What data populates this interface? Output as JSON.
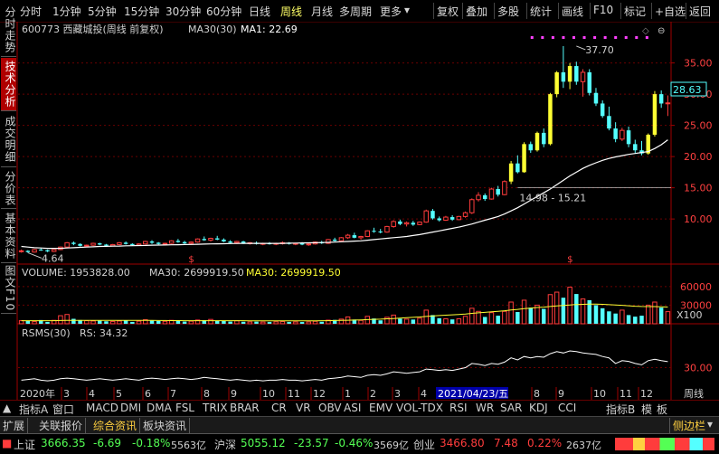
{
  "toolbar": {
    "periods": [
      "分时",
      "1分钟",
      "5分钟",
      "15分钟",
      "30分钟",
      "60分钟",
      "日线",
      "周线",
      "月线",
      "多周期",
      "更多"
    ],
    "active_period": "周线",
    "right_buttons": [
      "复权",
      "叠加",
      "多股",
      "统计",
      "画线",
      "F10",
      "标记",
      "+自选",
      "返回"
    ]
  },
  "left_tabs": [
    "分时走势",
    "技术分析",
    "成交明细",
    "分价表",
    "基本资料",
    "图文F10"
  ],
  "left_tabs_active": "技术分析",
  "header": {
    "stock": "600773 西藏城投(周线 前复权)",
    "ma30": "MA30(30)",
    "ma1": "MA1: 22.69"
  },
  "price_label": "28.63",
  "volume_header": {
    "volume": "VOLUME: 1953828.00",
    "ma30": "MA30: 2699919.50",
    "ma30b": "MA30: 2699919.50"
  },
  "volume_unit": "X100",
  "rsms_header": {
    "name": "RSMS(30)",
    "rs": "RS: 34.32"
  },
  "date_axis": {
    "labels": [
      "2020年",
      "3",
      "4",
      "5",
      "6",
      "7",
      "8",
      "9",
      "10",
      "11",
      "12",
      "1",
      "2",
      "3",
      "4",
      "2021/04/23/五",
      "8",
      "9",
      "10",
      "11",
      "12"
    ],
    "cursor_date": "2021/04/23/五",
    "right_label": "周线"
  },
  "indicator_tabs": [
    "指标A",
    "窗口",
    "MACD",
    "DMI",
    "DMA",
    "FSL",
    "TRIX",
    "BRAR",
    "CR",
    "VR",
    "OBV",
    "ASI",
    "EMV",
    "VOL-TDX",
    "RSI",
    "WR",
    "SAR",
    "KDJ",
    "CCI",
    "指标B",
    "模",
    "板"
  ],
  "sub_tabs": [
    "扩展",
    "关联报价",
    "综合资讯",
    "板块资讯"
  ],
  "sub_tabs_active": "综合资讯",
  "side_label": "侧边栏",
  "status": {
    "idx1_name": "上证",
    "idx1_val": "3666.35",
    "idx1_chg": "-6.69",
    "idx1_pct": "-0.18%",
    "idx1_amt": "5563亿",
    "idx2_name": "沪深",
    "idx2_val": "5055.12",
    "idx2_chg": "-23.57",
    "idx2_pct": "-0.46%",
    "idx2_amt": "3569亿",
    "idx3_name": "创业",
    "idx3_val": "3466.80",
    "idx3_chg": "7.48",
    "idx3_pct": "0.22%",
    "idx3_amt": "2637亿"
  },
  "colors": {
    "up": "#ff3c3c",
    "down": "#54ffff",
    "yellow": "#ffff33",
    "ma": "#ffffff",
    "grid": "#7a0000"
  },
  "chart_data": {
    "type": "candlestick",
    "title": "600773 西藏城投(周线 前复权)",
    "price_ylim": [
      3.5,
      39
    ],
    "price_ticks": [
      10.0,
      15.0,
      20.0,
      25.0,
      30.0,
      35.0
    ],
    "annotations": {
      "high": "37.70",
      "low": "4.64",
      "range_text": "14.98 - 15.21",
      "range_level": 15.0
    },
    "series": [
      {
        "name": "K",
        "values": [
          [
            4.8,
            5.1,
            4.6,
            4.9
          ],
          [
            4.9,
            5.0,
            4.6,
            4.7
          ],
          [
            4.7,
            5.2,
            4.6,
            5.1
          ],
          [
            5.1,
            5.4,
            4.9,
            5.0
          ],
          [
            5.0,
            5.1,
            4.7,
            4.8
          ],
          [
            4.8,
            5.2,
            4.7,
            5.1
          ],
          [
            5.1,
            5.6,
            5.0,
            5.5
          ],
          [
            5.5,
            6.3,
            5.3,
            6.2
          ],
          [
            6.2,
            6.4,
            5.8,
            6.0
          ],
          [
            6.0,
            6.1,
            5.6,
            5.7
          ],
          [
            5.7,
            5.9,
            5.5,
            5.8
          ],
          [
            5.8,
            6.2,
            5.7,
            6.1
          ],
          [
            6.1,
            6.2,
            5.8,
            5.9
          ],
          [
            5.9,
            6.0,
            5.6,
            5.7
          ],
          [
            5.7,
            6.0,
            5.6,
            5.9
          ],
          [
            5.9,
            6.3,
            5.8,
            6.2
          ],
          [
            6.2,
            6.4,
            5.9,
            6.0
          ],
          [
            6.0,
            6.1,
            5.7,
            5.8
          ],
          [
            5.8,
            6.1,
            5.7,
            6.0
          ],
          [
            6.0,
            6.5,
            5.9,
            6.4
          ],
          [
            6.4,
            6.6,
            6.0,
            6.2
          ],
          [
            6.2,
            6.3,
            5.9,
            6.0
          ],
          [
            6.0,
            6.2,
            5.8,
            6.1
          ],
          [
            6.1,
            6.6,
            6.0,
            6.5
          ],
          [
            6.5,
            6.8,
            6.2,
            6.3
          ],
          [
            6.3,
            6.5,
            6.0,
            6.1
          ],
          [
            6.1,
            6.4,
            5.9,
            6.3
          ],
          [
            6.3,
            6.9,
            6.2,
            6.8
          ],
          [
            6.8,
            7.2,
            6.5,
            6.6
          ],
          [
            6.6,
            7.0,
            6.4,
            6.9
          ],
          [
            6.9,
            7.3,
            6.6,
            6.7
          ],
          [
            6.7,
            6.9,
            6.3,
            6.4
          ],
          [
            6.4,
            6.6,
            6.1,
            6.2
          ],
          [
            6.2,
            6.5,
            6.0,
            6.4
          ],
          [
            6.4,
            6.5,
            6.0,
            6.1
          ],
          [
            6.1,
            6.3,
            5.9,
            6.2
          ],
          [
            6.2,
            6.4,
            5.9,
            6.0
          ],
          [
            6.0,
            6.2,
            5.8,
            6.1
          ],
          [
            6.1,
            6.3,
            5.9,
            6.0
          ],
          [
            6.0,
            6.2,
            5.8,
            6.1
          ],
          [
            6.1,
            6.4,
            5.9,
            6.2
          ],
          [
            6.2,
            6.3,
            5.9,
            6.0
          ],
          [
            6.0,
            6.2,
            5.8,
            6.1
          ],
          [
            6.1,
            6.3,
            5.8,
            5.9
          ],
          [
            5.9,
            6.1,
            5.7,
            6.0
          ],
          [
            6.0,
            6.4,
            5.9,
            6.3
          ],
          [
            6.3,
            6.5,
            6.0,
            6.1
          ],
          [
            6.1,
            6.8,
            6.0,
            6.7
          ],
          [
            6.7,
            7.0,
            6.4,
            6.5
          ],
          [
            6.5,
            7.1,
            6.4,
            7.0
          ],
          [
            7.0,
            7.6,
            6.8,
            7.4
          ],
          [
            7.4,
            7.8,
            6.9,
            7.0
          ],
          [
            7.0,
            7.3,
            6.7,
            7.2
          ],
          [
            7.2,
            8.2,
            7.1,
            8.1
          ],
          [
            8.1,
            8.6,
            7.8,
            8.0
          ],
          [
            8.0,
            8.4,
            7.7,
            7.9
          ],
          [
            7.9,
            8.9,
            7.8,
            8.8
          ],
          [
            8.8,
            9.8,
            8.6,
            9.6
          ],
          [
            9.6,
            9.9,
            9.0,
            9.2
          ],
          [
            9.2,
            9.6,
            8.8,
            9.4
          ],
          [
            9.4,
            9.7,
            8.9,
            9.1
          ],
          [
            9.1,
            9.6,
            9.0,
            9.5
          ],
          [
            9.5,
            11.5,
            9.4,
            11.3
          ],
          [
            11.3,
            11.6,
            9.9,
            10.1
          ],
          [
            10.1,
            10.4,
            9.6,
            9.8
          ],
          [
            9.8,
            10.5,
            9.7,
            10.3
          ],
          [
            10.3,
            10.6,
            9.7,
            9.9
          ],
          [
            9.9,
            10.5,
            9.8,
            10.4
          ],
          [
            10.4,
            11.2,
            10.2,
            11.0
          ],
          [
            11.0,
            13.3,
            10.8,
            13.1
          ],
          [
            13.1,
            14.3,
            12.8,
            13.8
          ],
          [
            13.8,
            14.1,
            12.9,
            13.2
          ],
          [
            13.2,
            15.0,
            13.1,
            14.8
          ],
          [
            14.8,
            15.3,
            13.6,
            13.9
          ],
          [
            13.9,
            16.2,
            13.8,
            16.0
          ],
          [
            16.0,
            19.3,
            15.6,
            18.9
          ],
          [
            18.9,
            20.2,
            17.3,
            17.5
          ],
          [
            17.5,
            22.3,
            17.4,
            22.0
          ],
          [
            22.0,
            22.4,
            20.6,
            21.0
          ],
          [
            21.0,
            24.0,
            20.8,
            23.8
          ],
          [
            23.8,
            24.5,
            21.5,
            22.0
          ],
          [
            22.0,
            30.2,
            21.8,
            30.0
          ],
          [
            30.0,
            33.7,
            29.5,
            33.5
          ],
          [
            33.5,
            37.7,
            31.0,
            32.0
          ],
          [
            32.0,
            35.0,
            30.8,
            34.5
          ],
          [
            34.5,
            35.2,
            31.5,
            32.0
          ],
          [
            32.0,
            34.0,
            29.6,
            33.5
          ],
          [
            33.5,
            34.0,
            29.8,
            30.2
          ],
          [
            30.2,
            31.0,
            28.1,
            28.5
          ],
          [
            28.5,
            29.0,
            26.2,
            26.5
          ],
          [
            26.5,
            28.0,
            24.2,
            24.5
          ],
          [
            24.5,
            25.5,
            22.3,
            22.8
          ],
          [
            22.8,
            24.6,
            22.5,
            24.2
          ],
          [
            24.2,
            24.8,
            21.5,
            22.0
          ],
          [
            22.0,
            22.7,
            20.5,
            21.0
          ],
          [
            21.0,
            22.5,
            20.2,
            20.5
          ],
          [
            20.5,
            23.7,
            20.3,
            23.5
          ],
          [
            23.5,
            30.5,
            23.2,
            30.0
          ],
          [
            30.0,
            30.6,
            27.8,
            28.5
          ],
          [
            28.5,
            29.8,
            26.5,
            28.6
          ]
        ]
      },
      {
        "name": "MA1",
        "values": [
          5.6,
          5.5,
          5.4,
          5.35,
          5.3,
          5.3,
          5.3,
          5.35,
          5.4,
          5.45,
          5.5,
          5.55,
          5.6,
          5.62,
          5.64,
          5.66,
          5.7,
          5.72,
          5.74,
          5.76,
          5.8,
          5.82,
          5.84,
          5.86,
          5.88,
          5.9,
          5.92,
          5.95,
          5.98,
          6.0,
          6.02,
          6.04,
          6.06,
          6.08,
          6.09,
          6.1,
          6.1,
          6.1,
          6.1,
          6.1,
          6.1,
          6.12,
          6.14,
          6.16,
          6.18,
          6.2,
          6.22,
          6.25,
          6.3,
          6.35,
          6.4,
          6.45,
          6.5,
          6.6,
          6.7,
          6.8,
          6.9,
          7.0,
          7.1,
          7.2,
          7.35,
          7.5,
          7.7,
          7.9,
          8.1,
          8.3,
          8.5,
          8.7,
          8.95,
          9.2,
          9.5,
          9.8,
          10.1,
          10.4,
          10.8,
          11.3,
          11.8,
          12.4,
          13.0,
          13.6,
          14.2,
          14.8,
          15.5,
          16.2,
          16.9,
          17.5,
          18.1,
          18.6,
          19.0,
          19.4,
          19.7,
          19.95,
          20.15,
          20.35,
          20.5,
          20.65,
          20.8,
          21.3,
          21.9,
          22.69
        ]
      }
    ],
    "volume": {
      "ylim": [
        0,
        70000
      ],
      "ticks": [
        30000,
        60000
      ],
      "values": [
        5000,
        4500,
        3500,
        6000,
        3000,
        5500,
        13000,
        15000,
        8000,
        6000,
        5000,
        4500,
        5000,
        4000,
        3800,
        4500,
        5200,
        3000,
        4200,
        6500,
        5000,
        4500,
        4000,
        5500,
        5200,
        3500,
        4200,
        6000,
        5800,
        7000,
        4800,
        5000,
        3500,
        4800,
        3200,
        3000,
        3400,
        2800,
        3000,
        3200,
        3600,
        3000,
        3000,
        2800,
        3000,
        4000,
        3200,
        5800,
        6200,
        7500,
        11000,
        6800,
        5500,
        12000,
        8500,
        5500,
        10500,
        14000,
        8200,
        7500,
        6800,
        9000,
        22000,
        14000,
        9000,
        8000,
        7000,
        8000,
        12000,
        25000,
        20000,
        11000,
        18000,
        13000,
        20000,
        35000,
        19000,
        38000,
        26000,
        30000,
        24000,
        47000,
        51000,
        42000,
        59000,
        48000,
        40000,
        38000,
        30000,
        25000,
        20000,
        16500,
        22000,
        14000,
        11500,
        13000,
        30000,
        35000,
        26000,
        19538
      ],
      "ma30": [
        5000,
        5000,
        5000,
        5000,
        5000,
        5000,
        5200,
        5400,
        5500,
        5600,
        5600,
        5600,
        5600,
        5600,
        5600,
        5600,
        5600,
        5600,
        5600,
        5500,
        5400,
        5300,
        5200,
        5100,
        5100,
        5000,
        5000,
        5000,
        5000,
        5000,
        5000,
        5000,
        4900,
        4900,
        4900,
        4800,
        4800,
        4800,
        4700,
        4700,
        4700,
        4700,
        4700,
        4700,
        4700,
        4800,
        4900,
        5000,
        5200,
        5400,
        5700,
        6000,
        6300,
        6700,
        7100,
        7500,
        8000,
        8500,
        9100,
        9700,
        10300,
        10900,
        11800,
        12500,
        13200,
        13800,
        14400,
        15000,
        15800,
        16700,
        17600,
        18400,
        19300,
        20100,
        21000,
        22300,
        23200,
        24400,
        25300,
        26200,
        26800,
        27800,
        28700,
        29500,
        30400,
        31000,
        31400,
        31600,
        31600,
        31300,
        30800,
        30200,
        29700,
        29000,
        28300,
        27800,
        27700,
        27700,
        27400,
        27000
      ]
    },
    "rsms": {
      "name": "RSMS(30)",
      "ylim": [
        18,
        55
      ],
      "ticks": [
        30
      ],
      "values": [
        21,
        21.5,
        22,
        21,
        20.5,
        21,
        22,
        22.5,
        22,
        21.5,
        21,
        21.5,
        22,
        21.5,
        21,
        21.5,
        22,
        21.5,
        21,
        22,
        22.5,
        22,
        21.5,
        22,
        22.5,
        22,
        21.5,
        22,
        23,
        22.5,
        22,
        21.5,
        21,
        21.5,
        21,
        20.5,
        21,
        20.5,
        21,
        21,
        21.5,
        21,
        21,
        20.5,
        21,
        21.5,
        21,
        22,
        22.5,
        23,
        24,
        23.5,
        23,
        24.5,
        25,
        24.5,
        25.5,
        27,
        26.5,
        26,
        26.5,
        27,
        29,
        28.5,
        28,
        28.5,
        28,
        29,
        30,
        33,
        32.5,
        31.5,
        33,
        32.5,
        34,
        37,
        35.5,
        38,
        37,
        38,
        37.5,
        40,
        41.5,
        40.5,
        42,
        41.5,
        40.5,
        40,
        39.5,
        38,
        37,
        33,
        35,
        34.5,
        33,
        32,
        35,
        36,
        35,
        34.32
      ]
    }
  }
}
